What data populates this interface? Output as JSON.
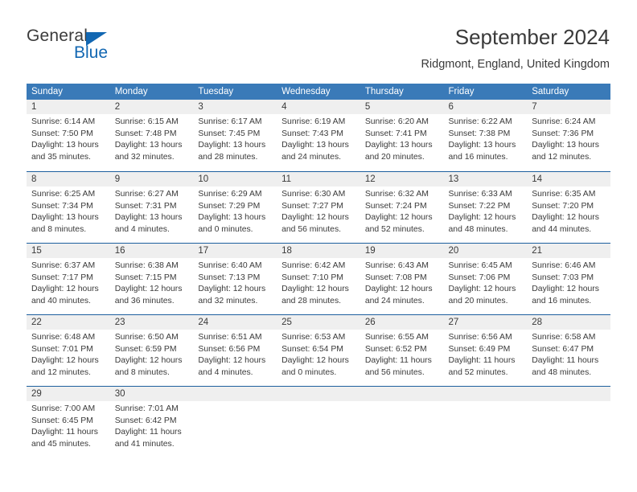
{
  "logo": {
    "text_top": "General",
    "text_bottom": "Blue",
    "triangle_color": "#1267b2",
    "blue_color": "#1267b2",
    "dark_color": "#3b3b3b"
  },
  "header": {
    "title": "September 2024",
    "subtitle": "Ridgmont, England, United Kingdom"
  },
  "theme": {
    "header_blue": "#3a7ab8",
    "row_line_blue": "#1d5f9e",
    "day_band_gray": "#efefef",
    "text_color": "#3a3a3a"
  },
  "weekdays": [
    "Sunday",
    "Monday",
    "Tuesday",
    "Wednesday",
    "Thursday",
    "Friday",
    "Saturday"
  ],
  "weeks": [
    [
      {
        "day": "1",
        "sunrise": "Sunrise: 6:14 AM",
        "sunset": "Sunset: 7:50 PM",
        "daylight1": "Daylight: 13 hours",
        "daylight2": "and 35 minutes."
      },
      {
        "day": "2",
        "sunrise": "Sunrise: 6:15 AM",
        "sunset": "Sunset: 7:48 PM",
        "daylight1": "Daylight: 13 hours",
        "daylight2": "and 32 minutes."
      },
      {
        "day": "3",
        "sunrise": "Sunrise: 6:17 AM",
        "sunset": "Sunset: 7:45 PM",
        "daylight1": "Daylight: 13 hours",
        "daylight2": "and 28 minutes."
      },
      {
        "day": "4",
        "sunrise": "Sunrise: 6:19 AM",
        "sunset": "Sunset: 7:43 PM",
        "daylight1": "Daylight: 13 hours",
        "daylight2": "and 24 minutes."
      },
      {
        "day": "5",
        "sunrise": "Sunrise: 6:20 AM",
        "sunset": "Sunset: 7:41 PM",
        "daylight1": "Daylight: 13 hours",
        "daylight2": "and 20 minutes."
      },
      {
        "day": "6",
        "sunrise": "Sunrise: 6:22 AM",
        "sunset": "Sunset: 7:38 PM",
        "daylight1": "Daylight: 13 hours",
        "daylight2": "and 16 minutes."
      },
      {
        "day": "7",
        "sunrise": "Sunrise: 6:24 AM",
        "sunset": "Sunset: 7:36 PM",
        "daylight1": "Daylight: 13 hours",
        "daylight2": "and 12 minutes."
      }
    ],
    [
      {
        "day": "8",
        "sunrise": "Sunrise: 6:25 AM",
        "sunset": "Sunset: 7:34 PM",
        "daylight1": "Daylight: 13 hours",
        "daylight2": "and 8 minutes."
      },
      {
        "day": "9",
        "sunrise": "Sunrise: 6:27 AM",
        "sunset": "Sunset: 7:31 PM",
        "daylight1": "Daylight: 13 hours",
        "daylight2": "and 4 minutes."
      },
      {
        "day": "10",
        "sunrise": "Sunrise: 6:29 AM",
        "sunset": "Sunset: 7:29 PM",
        "daylight1": "Daylight: 13 hours",
        "daylight2": "and 0 minutes."
      },
      {
        "day": "11",
        "sunrise": "Sunrise: 6:30 AM",
        "sunset": "Sunset: 7:27 PM",
        "daylight1": "Daylight: 12 hours",
        "daylight2": "and 56 minutes."
      },
      {
        "day": "12",
        "sunrise": "Sunrise: 6:32 AM",
        "sunset": "Sunset: 7:24 PM",
        "daylight1": "Daylight: 12 hours",
        "daylight2": "and 52 minutes."
      },
      {
        "day": "13",
        "sunrise": "Sunrise: 6:33 AM",
        "sunset": "Sunset: 7:22 PM",
        "daylight1": "Daylight: 12 hours",
        "daylight2": "and 48 minutes."
      },
      {
        "day": "14",
        "sunrise": "Sunrise: 6:35 AM",
        "sunset": "Sunset: 7:20 PM",
        "daylight1": "Daylight: 12 hours",
        "daylight2": "and 44 minutes."
      }
    ],
    [
      {
        "day": "15",
        "sunrise": "Sunrise: 6:37 AM",
        "sunset": "Sunset: 7:17 PM",
        "daylight1": "Daylight: 12 hours",
        "daylight2": "and 40 minutes."
      },
      {
        "day": "16",
        "sunrise": "Sunrise: 6:38 AM",
        "sunset": "Sunset: 7:15 PM",
        "daylight1": "Daylight: 12 hours",
        "daylight2": "and 36 minutes."
      },
      {
        "day": "17",
        "sunrise": "Sunrise: 6:40 AM",
        "sunset": "Sunset: 7:13 PM",
        "daylight1": "Daylight: 12 hours",
        "daylight2": "and 32 minutes."
      },
      {
        "day": "18",
        "sunrise": "Sunrise: 6:42 AM",
        "sunset": "Sunset: 7:10 PM",
        "daylight1": "Daylight: 12 hours",
        "daylight2": "and 28 minutes."
      },
      {
        "day": "19",
        "sunrise": "Sunrise: 6:43 AM",
        "sunset": "Sunset: 7:08 PM",
        "daylight1": "Daylight: 12 hours",
        "daylight2": "and 24 minutes."
      },
      {
        "day": "20",
        "sunrise": "Sunrise: 6:45 AM",
        "sunset": "Sunset: 7:06 PM",
        "daylight1": "Daylight: 12 hours",
        "daylight2": "and 20 minutes."
      },
      {
        "day": "21",
        "sunrise": "Sunrise: 6:46 AM",
        "sunset": "Sunset: 7:03 PM",
        "daylight1": "Daylight: 12 hours",
        "daylight2": "and 16 minutes."
      }
    ],
    [
      {
        "day": "22",
        "sunrise": "Sunrise: 6:48 AM",
        "sunset": "Sunset: 7:01 PM",
        "daylight1": "Daylight: 12 hours",
        "daylight2": "and 12 minutes."
      },
      {
        "day": "23",
        "sunrise": "Sunrise: 6:50 AM",
        "sunset": "Sunset: 6:59 PM",
        "daylight1": "Daylight: 12 hours",
        "daylight2": "and 8 minutes."
      },
      {
        "day": "24",
        "sunrise": "Sunrise: 6:51 AM",
        "sunset": "Sunset: 6:56 PM",
        "daylight1": "Daylight: 12 hours",
        "daylight2": "and 4 minutes."
      },
      {
        "day": "25",
        "sunrise": "Sunrise: 6:53 AM",
        "sunset": "Sunset: 6:54 PM",
        "daylight1": "Daylight: 12 hours",
        "daylight2": "and 0 minutes."
      },
      {
        "day": "26",
        "sunrise": "Sunrise: 6:55 AM",
        "sunset": "Sunset: 6:52 PM",
        "daylight1": "Daylight: 11 hours",
        "daylight2": "and 56 minutes."
      },
      {
        "day": "27",
        "sunrise": "Sunrise: 6:56 AM",
        "sunset": "Sunset: 6:49 PM",
        "daylight1": "Daylight: 11 hours",
        "daylight2": "and 52 minutes."
      },
      {
        "day": "28",
        "sunrise": "Sunrise: 6:58 AM",
        "sunset": "Sunset: 6:47 PM",
        "daylight1": "Daylight: 11 hours",
        "daylight2": "and 48 minutes."
      }
    ],
    [
      {
        "day": "29",
        "sunrise": "Sunrise: 7:00 AM",
        "sunset": "Sunset: 6:45 PM",
        "daylight1": "Daylight: 11 hours",
        "daylight2": "and 45 minutes."
      },
      {
        "day": "30",
        "sunrise": "Sunrise: 7:01 AM",
        "sunset": "Sunset: 6:42 PM",
        "daylight1": "Daylight: 11 hours",
        "daylight2": "and 41 minutes."
      },
      {
        "day": "",
        "sunrise": "",
        "sunset": "",
        "daylight1": "",
        "daylight2": ""
      },
      {
        "day": "",
        "sunrise": "",
        "sunset": "",
        "daylight1": "",
        "daylight2": ""
      },
      {
        "day": "",
        "sunrise": "",
        "sunset": "",
        "daylight1": "",
        "daylight2": ""
      },
      {
        "day": "",
        "sunrise": "",
        "sunset": "",
        "daylight1": "",
        "daylight2": ""
      },
      {
        "day": "",
        "sunrise": "",
        "sunset": "",
        "daylight1": "",
        "daylight2": ""
      }
    ]
  ]
}
